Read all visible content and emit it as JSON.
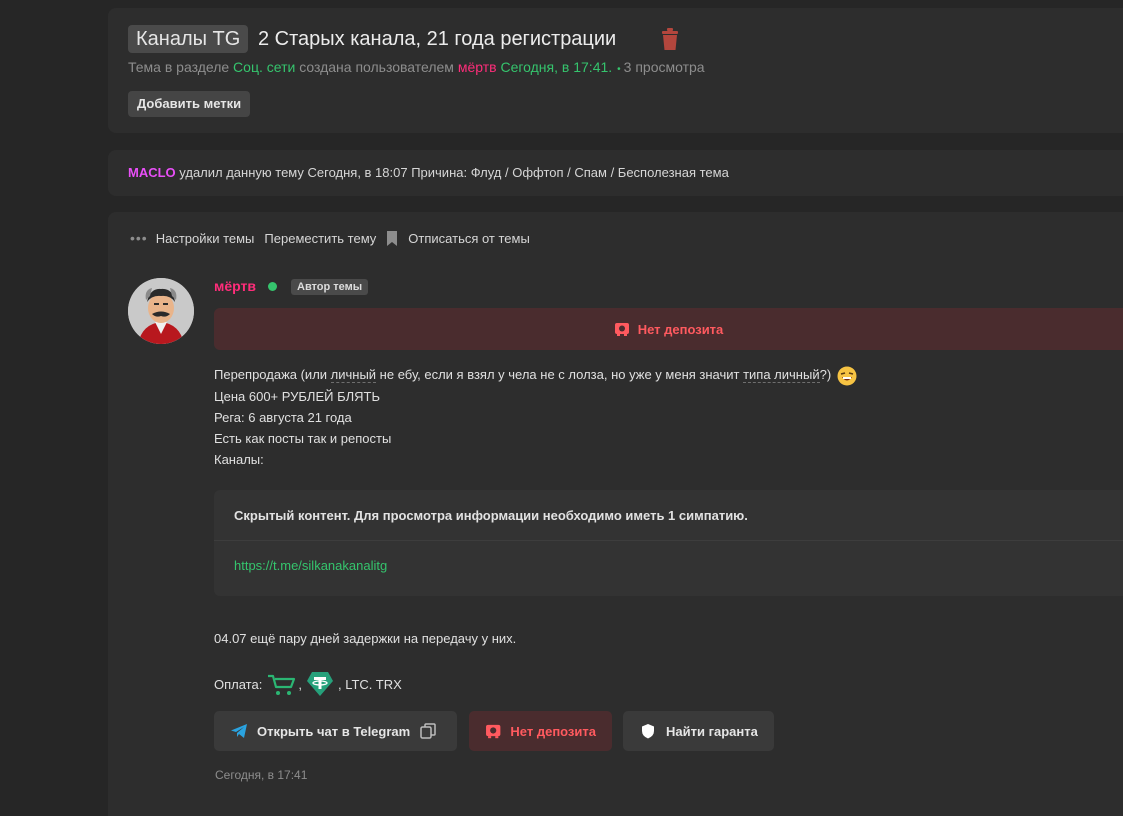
{
  "header": {
    "prefix": "Каналы TG",
    "title": "2 Старых канала, 21 года регистрации",
    "meta_prefix": "Тема в разделе",
    "section": "Соц. сети",
    "meta_mid": "создана пользователем",
    "author": "мёртв",
    "created": "Сегодня, в 17:41.",
    "views": "3 просмотра",
    "add_tags": "Добавить метки"
  },
  "deletion": {
    "moderator": "MACLO",
    "text": "удалил данную тему Сегодня, в 18:07 Причина: Флуд / Оффтоп / Спам / Бесполезная тема"
  },
  "tools": {
    "settings": "Настройки темы",
    "move": "Переместить тему",
    "unsubscribe": "Отписаться от темы"
  },
  "post": {
    "username": "мёртв",
    "author_badge": "Автор темы",
    "deposit_banner": "Нет депозита",
    "line1_a": "Перепродажа (или ",
    "line1_u1": "личный",
    "line1_b": " не ебу, если я взял у чела не с лолза, но уже у меня значит ",
    "line1_u2": "типа личный",
    "line1_c": "?)",
    "line2": "Цена 600+ РУБЛЕЙ БЛЯТЬ",
    "line3": "Рега: 6 августа 21 года",
    "line4": "Есть как посты так и репосты",
    "line5": "Каналы:",
    "hidden_title": "Скрытый контент. Для просмотра информации необходимо иметь 1 симпатию.",
    "hidden_link": "https://t.me/silkanakanalitg",
    "delay": "04.07 ещё пару дней задержки на передачу у них.",
    "pay_label": "Оплата:",
    "pay_sep": ",",
    "pay_rest": ", LTC. TRX",
    "btn_telegram": "Открыть чат в Telegram",
    "btn_deposit": "Нет депозита",
    "btn_guarantor": "Найти гаранта",
    "date": "Сегодня, в 17:41"
  },
  "colors": {
    "accent_green": "#35c46d",
    "username_pink": "#ff2d7a",
    "moderator_purple": "#e84ff7",
    "deposit_red": "#ff5a5f"
  }
}
